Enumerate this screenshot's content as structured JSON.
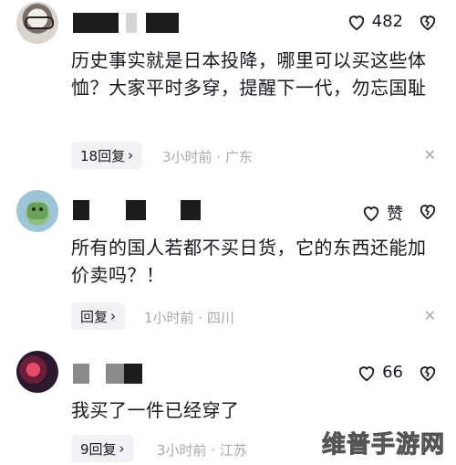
{
  "comments": [
    {
      "like_count": "482",
      "text": "历史事实就是日本投降，哪里可以买这些体恤？大家平时多穿，提醒下一代，勿忘国耻",
      "reply_label": "18回复",
      "meta": "3小时前 · 广东"
    },
    {
      "like_count": "赞",
      "text": "所有的国人若都不买日货，它的东西还能加价卖吗？！",
      "reply_label": "回复",
      "meta": "1小时前 · 四川"
    },
    {
      "like_count": "66",
      "text": "我买了一件已经穿了",
      "reply_label": "9回复",
      "meta": "3小时前 · 江苏"
    }
  ],
  "icons": {
    "like": "heart-outline-icon",
    "dislike": "broken-heart-icon",
    "chevron": "chevron-right-icon",
    "close": "close-icon"
  },
  "watermark": "维普手游网"
}
